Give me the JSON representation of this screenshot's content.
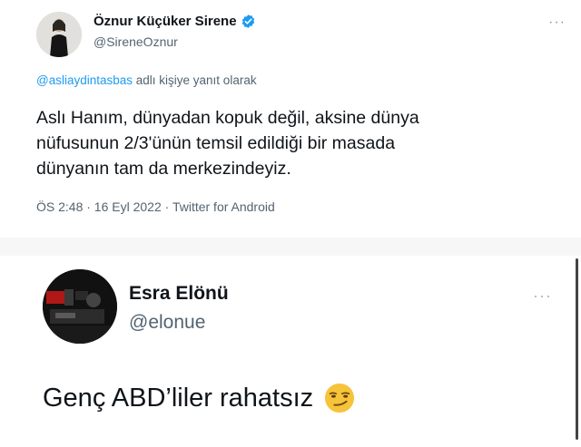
{
  "tweet1": {
    "display_name": "Öznur Küçüker Sirene",
    "handle": "@SireneOznur",
    "reply_mention": "@asliaydintasbas",
    "reply_suffix": " adlı kişiye yanıt olarak",
    "body_lines": [
      "Aslı Hanım, dünyadan kopuk değil, aksine dünya",
      "nüfusunun 2/3'ünün temsil edildiği bir masada",
      "dünyanın tam da merkezindeyiz."
    ],
    "meta": "ÖS 2:48 · 16 Eyl 2022 · Twitter for Android",
    "more": "···"
  },
  "tweet2": {
    "display_name": "Esra Elönü",
    "handle": "@elonue",
    "body": "Genç ABD’liler rahatsız",
    "more": "···",
    "emoji": "smirking-face"
  },
  "colors": {
    "verified": "#1d9bf0",
    "link": "#1d9bf0",
    "secondary_text": "#536471",
    "primary_text": "#0f1419"
  }
}
